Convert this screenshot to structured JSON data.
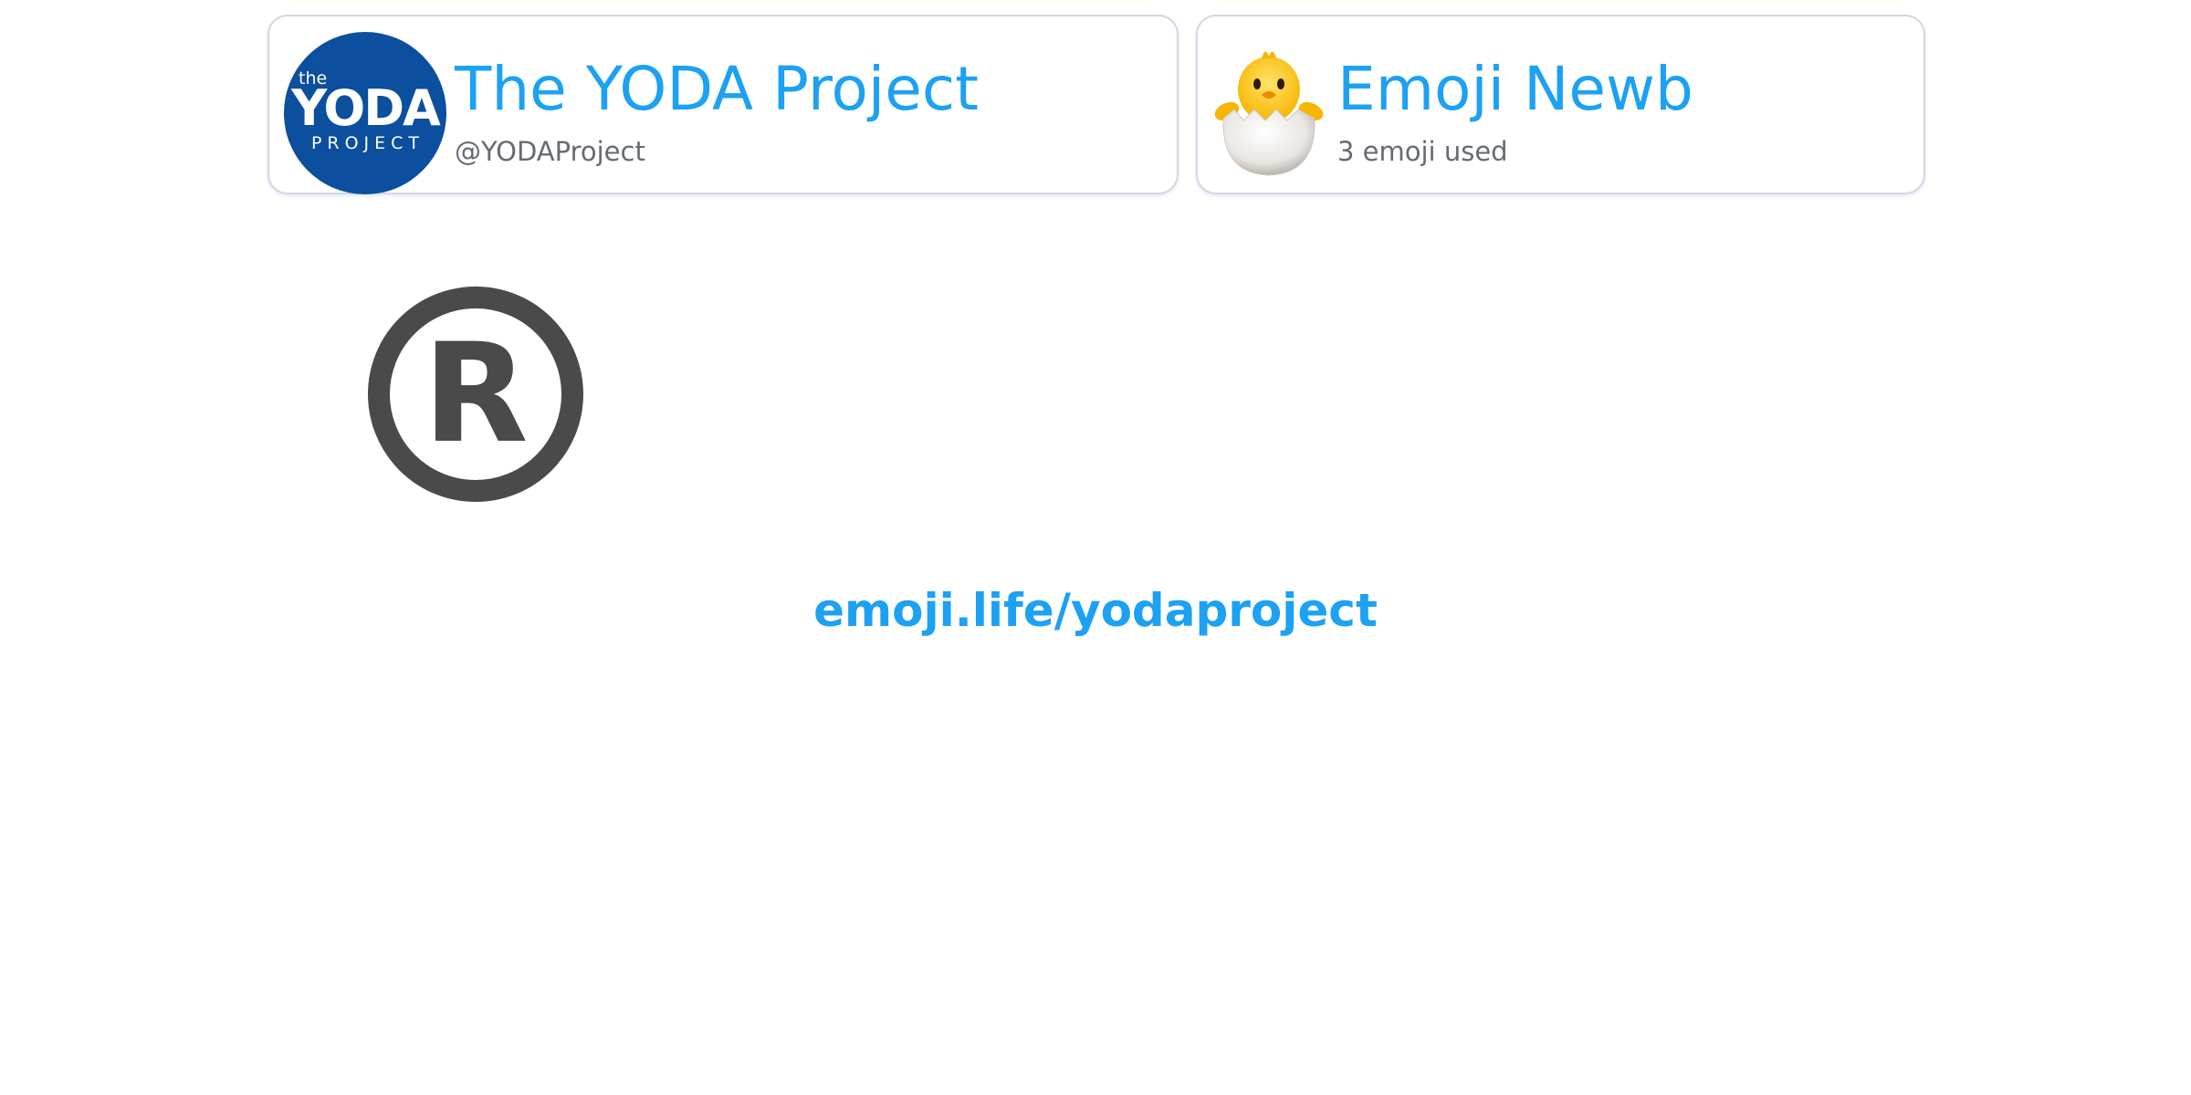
{
  "profile": {
    "name": "The YODA Project",
    "handle": "@YODAProject",
    "avatar_logo": {
      "line1": "the",
      "line2": "YODA",
      "line3": "PROJECT"
    }
  },
  "rank": {
    "title": "Emoji Newb",
    "subtitle": "3 emoji used",
    "icon": "hatching-chick-icon"
  },
  "featured_emoji": {
    "icon": "registered-sign-icon",
    "glyph": "R"
  },
  "share_link": "emoji.life/yodaproject",
  "colors": {
    "accent": "#1da1f2",
    "avatar_bg": "#0b4f9e",
    "muted_text": "#666a73",
    "card_border": "#d3d6e6",
    "emoji_gray": "#4a4a4a"
  }
}
